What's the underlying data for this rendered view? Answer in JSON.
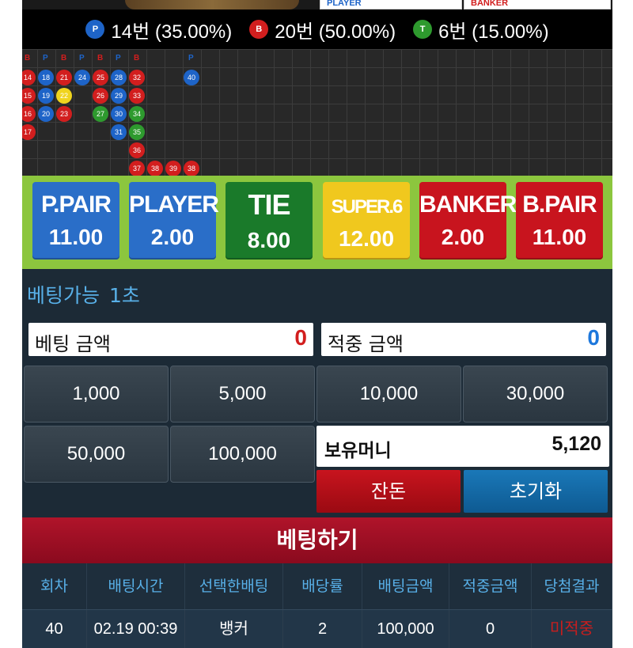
{
  "colors": {
    "player": "#1e64c8",
    "banker": "#d21e1e",
    "tie": "#2e9a2e",
    "yellow": "#f0d41e"
  },
  "top_cards": {
    "player_label": "PLAYER",
    "banker_label": "BANKER"
  },
  "stats": [
    {
      "icon": "player-dot-icon",
      "letter": "P",
      "text": "14번 (35.00%)",
      "color": "#1e64c8"
    },
    {
      "icon": "banker-dot-icon",
      "letter": "B",
      "text": "20번 (50.00%)",
      "color": "#d21e1e"
    },
    {
      "icon": "tie-dot-icon",
      "letter": "T",
      "text": "6번 (15.00%)",
      "color": "#2e9a2e"
    }
  ],
  "road": {
    "header_labels": [
      "B",
      "P",
      "B",
      "P",
      "B",
      "P",
      "B",
      "",
      "",
      "P"
    ],
    "columns": [
      [
        {
          "n": "14",
          "c": "B"
        },
        {
          "n": "15",
          "c": "B"
        },
        {
          "n": "16",
          "c": "B"
        },
        {
          "n": "17",
          "c": "B"
        }
      ],
      [
        {
          "n": "18",
          "c": "P"
        },
        {
          "n": "19",
          "c": "P"
        },
        {
          "n": "20",
          "c": "P"
        }
      ],
      [
        {
          "n": "21",
          "c": "B"
        },
        {
          "n": "22",
          "c": "Y"
        },
        {
          "n": "23",
          "c": "B"
        }
      ],
      [
        {
          "n": "24",
          "c": "P"
        }
      ],
      [
        {
          "n": "25",
          "c": "B"
        },
        {
          "n": "26",
          "c": "B"
        },
        {
          "n": "27",
          "c": "T"
        }
      ],
      [
        {
          "n": "28",
          "c": "P"
        },
        {
          "n": "29",
          "c": "P"
        },
        {
          "n": "30",
          "c": "P"
        },
        {
          "n": "31",
          "c": "P"
        }
      ],
      [
        {
          "n": "32",
          "c": "B"
        },
        {
          "n": "33",
          "c": "B"
        },
        {
          "n": "34",
          "c": "T"
        },
        {
          "n": "35",
          "c": "T"
        },
        {
          "n": "36",
          "c": "B"
        },
        {
          "n": "37",
          "c": "B"
        }
      ],
      [
        {
          "n": "",
          "c": ""
        },
        {
          "n": "",
          "c": ""
        },
        {
          "n": "",
          "c": ""
        },
        {
          "n": "",
          "c": ""
        },
        {
          "n": "",
          "c": ""
        },
        {
          "n": "38",
          "c": "B"
        }
      ],
      [
        {
          "n": "",
          "c": ""
        },
        {
          "n": "",
          "c": ""
        },
        {
          "n": "",
          "c": ""
        },
        {
          "n": "",
          "c": ""
        },
        {
          "n": "",
          "c": ""
        },
        {
          "n": "39",
          "c": "B"
        }
      ],
      [
        {
          "n": "40",
          "c": "P"
        },
        {
          "n": "",
          "c": ""
        },
        {
          "n": "",
          "c": ""
        },
        {
          "n": "",
          "c": ""
        },
        {
          "n": "",
          "c": ""
        },
        {
          "n": "38",
          "c": "B"
        }
      ]
    ]
  },
  "bets": [
    {
      "label": "P.PAIR",
      "odds": "11.00",
      "color": "#2a6ec8"
    },
    {
      "label": "PLAYER",
      "odds": "2.00",
      "color": "#2a6ec8"
    },
    {
      "label": "TIE",
      "odds": "8.00",
      "color": "#1a7a2a"
    },
    {
      "label": "SUPER.6",
      "odds": "12.00",
      "color": "#f0c81e"
    },
    {
      "label": "BANKER",
      "odds": "2.00",
      "color": "#c8141e"
    },
    {
      "label": "B.PAIR",
      "odds": "11.00",
      "color": "#c8141e"
    }
  ],
  "panel": {
    "avail_label": "베팅가능",
    "avail_time": "1초",
    "bet_amount_label": "베팅 금액",
    "bet_amount_value": "0",
    "bet_amount_color": "#d21e1e",
    "win_amount_label": "적중 금액",
    "win_amount_value": "0",
    "win_amount_color": "#1e78dc",
    "chips": [
      "1,000",
      "5,000",
      "10,000",
      "30,000",
      "50,000",
      "100,000"
    ],
    "balance_label": "보유머니",
    "balance_value": "5,120",
    "change_label": "잔돈",
    "reset_label": "초기화"
  },
  "submit_label": "베팅하기",
  "table": {
    "headers": [
      "회차",
      "배팅시간",
      "선택한배팅",
      "배당률",
      "배팅금액",
      "적중금액",
      "당첨결과"
    ],
    "rows": [
      [
        "40",
        "02.19 00:39",
        "뱅커",
        "2",
        "100,000",
        "0",
        "미적중"
      ]
    ]
  }
}
